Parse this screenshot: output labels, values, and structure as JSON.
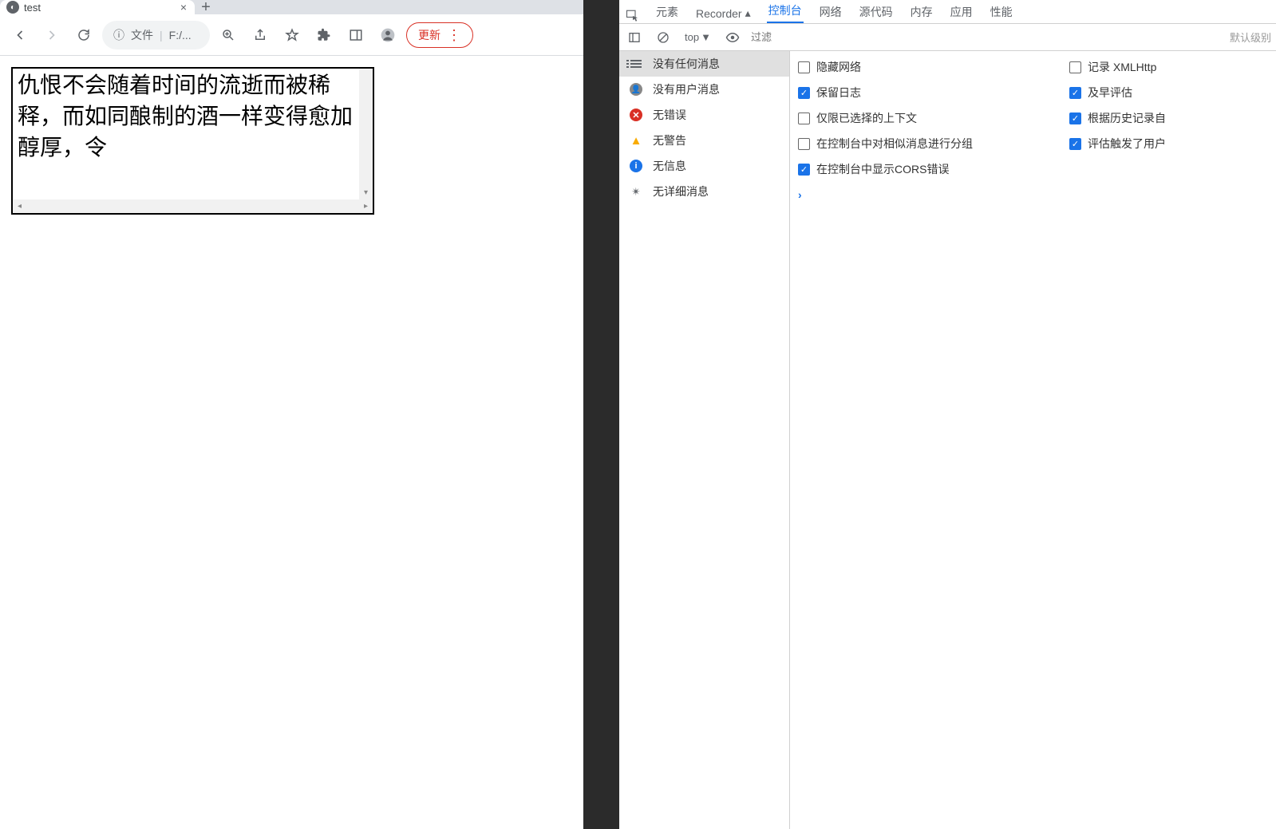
{
  "browser": {
    "tab_title": "test",
    "address_label": "文件",
    "address_path": "F:/...",
    "update_button": "更新"
  },
  "page": {
    "textbox_content": "仇恨不会随着时间的流逝而被稀释，而如同酿制的酒一样变得愈加醇厚，令"
  },
  "devtools": {
    "tabs": {
      "elements": "元素",
      "recorder": "Recorder",
      "console": "控制台",
      "network": "网络",
      "sources": "源代码",
      "memory": "内存",
      "application": "应用",
      "performance": "性能"
    },
    "console_toolbar": {
      "context": "top",
      "filter_placeholder": "过滤",
      "levels": "默认级别"
    },
    "sidebar": {
      "items": [
        {
          "label": "没有任何消息"
        },
        {
          "label": "没有用户消息"
        },
        {
          "label": "无错误"
        },
        {
          "label": "无警告"
        },
        {
          "label": "无信息"
        },
        {
          "label": "无详细消息"
        }
      ]
    },
    "settings": {
      "col1": [
        {
          "label": "隐藏网络",
          "checked": false
        },
        {
          "label": "保留日志",
          "checked": true
        },
        {
          "label": "仅限已选择的上下文",
          "checked": false
        },
        {
          "label": "在控制台中对相似消息进行分组",
          "checked": false
        },
        {
          "label": "在控制台中显示CORS错误",
          "checked": true
        }
      ],
      "col2": [
        {
          "label": "记录 XMLHttp",
          "checked": false
        },
        {
          "label": "及早评估",
          "checked": true
        },
        {
          "label": "根据历史记录自",
          "checked": true
        },
        {
          "label": "评估触发了用户",
          "checked": true
        }
      ]
    }
  }
}
